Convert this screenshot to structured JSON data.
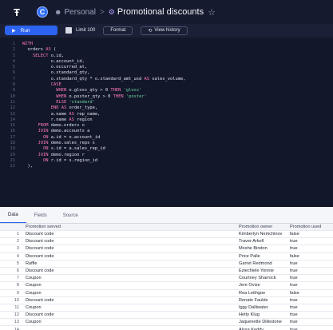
{
  "header": {
    "logo_glyph": "Ŧ",
    "avatar_initial": "C",
    "workspace": "Personal",
    "separator": ">",
    "query_title": "Promotional discounts",
    "star_glyph": "☆"
  },
  "toolbar": {
    "run_label": "Run",
    "limit_label": "Limit 100",
    "format_label": "Format",
    "history_label": "View history"
  },
  "editor": {
    "lines": [
      "WITH",
      "  orders AS (",
      "    SELECT o.id,",
      "           o.account_id,",
      "           o.occurred_at,",
      "           o.standard_qty,",
      "           o.standard_qty * o.standard_amt_usd AS sales_volume,",
      "           CASE",
      "             WHEN o.gloss_qty > 0 THEN 'gloss'",
      "             WHEN o.poster_qty > 0 THEN 'poster'",
      "             ELSE 'standard'",
      "           END AS order_type,",
      "           a.name AS rep_name,",
      "           r.name AS region",
      "      FROM demo.orders o",
      "      JOIN demo.accounts a",
      "        ON a.id = o.account_id",
      "      JOIN demo.sales_reps s",
      "        ON s.id = a.sales_rep_id",
      "      JOIN demo.region r",
      "        ON r.id = s.region_id",
      "  ),"
    ]
  },
  "tabs": [
    "Data",
    "Fields",
    "Source"
  ],
  "table": {
    "columns": [
      "Promotion served",
      "Promotion owner",
      "Promotion used"
    ],
    "rows": [
      {
        "n": "1",
        "served": "Discount code",
        "owner": "Kimberlyn Nemchinov",
        "used": "false"
      },
      {
        "n": "2",
        "served": "Discount code",
        "owner": "Traver Arkell",
        "used": "true"
      },
      {
        "n": "3",
        "served": "Discount code",
        "owner": "Moshe Bindon",
        "used": "true"
      },
      {
        "n": "4",
        "served": "Discount code",
        "owner": "Price Palle",
        "used": "false"
      },
      {
        "n": "5",
        "served": "Raffle",
        "owner": "Garret Redmond",
        "used": "true"
      },
      {
        "n": "6",
        "served": "Discount code",
        "owner": "Eziechiele Yonnie",
        "used": "true"
      },
      {
        "n": "7",
        "served": "Coupon",
        "owner": "Courtney Sharrock",
        "used": "true"
      },
      {
        "n": "8",
        "served": "Coupon",
        "owner": "Jere Ovize",
        "used": "true"
      },
      {
        "n": "9",
        "served": "Coupon",
        "owner": "Rea Leithgoe",
        "used": "false"
      },
      {
        "n": "10",
        "served": "Discount code",
        "owner": "Renate Faulds",
        "used": "true"
      },
      {
        "n": "11",
        "served": "Coupon",
        "owner": "Iggy Dalliwater",
        "used": "true"
      },
      {
        "n": "12",
        "served": "Discount code",
        "owner": "Hetty Klug",
        "used": "true"
      },
      {
        "n": "13",
        "served": "Coupon",
        "owner": "Jaquenette Dillestone",
        "used": "true"
      },
      {
        "n": "14",
        "served": "",
        "owner": "Alysa Keddy",
        "used": "true"
      }
    ]
  },
  "colors": {
    "accent": "#2c63f0",
    "background": "#1b2036",
    "editor_background": "#12172a",
    "keyword": "#ff7ab8",
    "string": "#6fd3a0"
  }
}
